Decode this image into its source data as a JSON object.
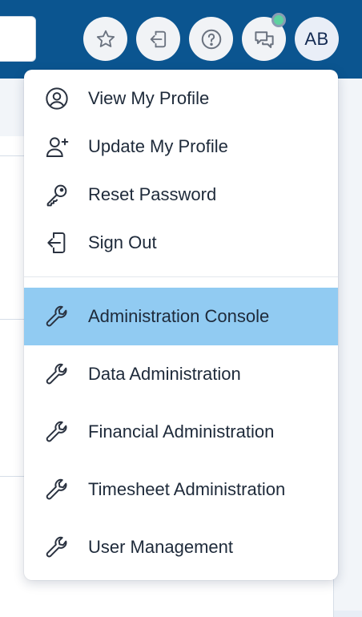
{
  "header": {
    "avatar_initials": "AB",
    "buttons": [
      {
        "icon": "star-icon"
      },
      {
        "icon": "sign-out-icon"
      },
      {
        "icon": "help-icon"
      },
      {
        "icon": "chat-icon"
      }
    ],
    "notification_color": "#5ed2a0",
    "brand_color": "#0b5590"
  },
  "user_menu": {
    "account_items": [
      {
        "label": "View My Profile",
        "icon": "user-circle-icon"
      },
      {
        "label": "Update My Profile",
        "icon": "user-plus-icon"
      },
      {
        "label": "Reset Password",
        "icon": "key-icon"
      },
      {
        "label": "Sign Out",
        "icon": "sign-out-icon"
      }
    ],
    "admin_items": [
      {
        "label": "Administration Console",
        "icon": "wrench-icon",
        "highlighted": true
      },
      {
        "label": "Data Administration",
        "icon": "wrench-icon"
      },
      {
        "label": "Financial Administration",
        "icon": "wrench-icon"
      },
      {
        "label": "Timesheet Administration",
        "icon": "wrench-icon"
      },
      {
        "label": "User Management",
        "icon": "wrench-icon"
      }
    ],
    "highlight_color": "#91cbf2"
  }
}
